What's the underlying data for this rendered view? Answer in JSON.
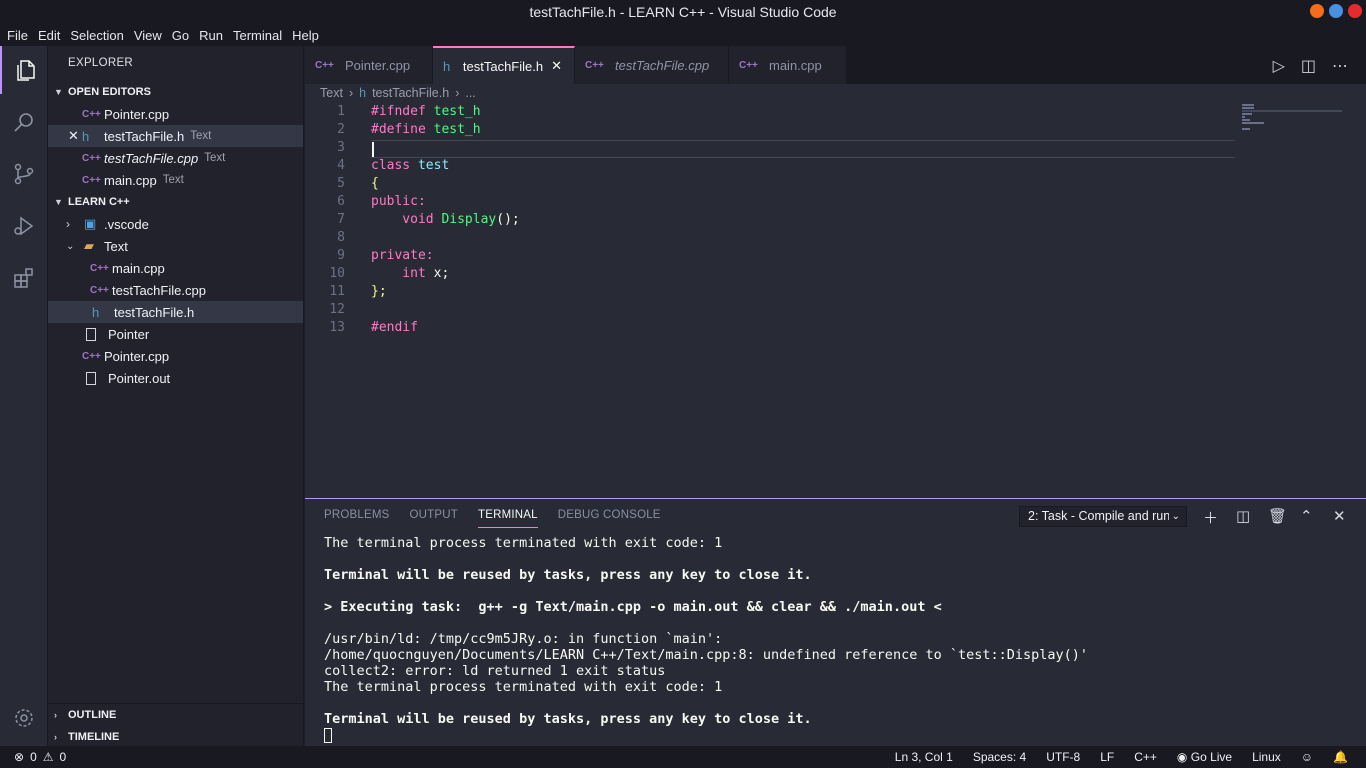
{
  "window": {
    "title": "testTachFile.h - LEARN C++ - Visual Studio Code",
    "buttons": {
      "minimize_color": "#f46d1b",
      "maximize_color": "#4a90e2",
      "close_color": "#e52b2b"
    }
  },
  "menu": [
    "File",
    "Edit",
    "Selection",
    "View",
    "Go",
    "Run",
    "Terminal",
    "Help"
  ],
  "activity": [
    "files-icon",
    "search-icon",
    "source-control-icon",
    "run-debug-icon",
    "extensions-icon",
    "settings-gear-icon"
  ],
  "sidebar": {
    "title": "EXPLORER",
    "open_editors": {
      "header": "OPEN EDITORS",
      "items": [
        {
          "name": "Pointer.cpp",
          "desc": "",
          "icon": "cpp"
        },
        {
          "name": "testTachFile.h",
          "desc": "Text",
          "icon": "h"
        },
        {
          "name": "testTachFile.cpp",
          "desc": "Text",
          "icon": "cpp"
        },
        {
          "name": "main.cpp",
          "desc": "Text",
          "icon": "cpp"
        }
      ]
    },
    "workspace": {
      "header": "LEARN C++",
      "items": [
        {
          "name": ".vscode",
          "type": "folder-collapsed"
        },
        {
          "name": "Text",
          "type": "folder-open"
        },
        {
          "name": "main.cpp",
          "type": "cpp"
        },
        {
          "name": "testTachFile.cpp",
          "type": "cpp"
        },
        {
          "name": "testTachFile.h",
          "type": "h"
        },
        {
          "name": "Pointer",
          "type": "file"
        },
        {
          "name": "Pointer.cpp",
          "type": "cpp"
        },
        {
          "name": "Pointer.out",
          "type": "file"
        }
      ]
    },
    "outline": "OUTLINE",
    "timeline": "TIMELINE"
  },
  "tabs": [
    {
      "label": "Pointer.cpp",
      "icon": "C++"
    },
    {
      "label": "testTachFile.h",
      "icon": "h"
    },
    {
      "label": "testTachFile.cpp",
      "icon": "C++"
    },
    {
      "label": "main.cpp",
      "icon": "C++"
    }
  ],
  "breadcrumb": {
    "folder": "Text",
    "file": "testTachFile.h",
    "more": "..."
  },
  "editor": {
    "lines": [
      [
        {
          "t": "#ifndef ",
          "c": "kw"
        },
        {
          "t": "test_h",
          "c": "fn"
        }
      ],
      [
        {
          "t": "#define ",
          "c": "kw"
        },
        {
          "t": "test_h",
          "c": "fn"
        }
      ],
      [],
      [
        {
          "t": "class ",
          "c": "kw"
        },
        {
          "t": "test",
          "c": "cls"
        }
      ],
      [
        {
          "t": "{",
          "c": "br"
        }
      ],
      [
        {
          "t": "public:",
          "c": "kw"
        }
      ],
      [
        {
          "t": "    void ",
          "c": "kw"
        },
        {
          "t": "Display",
          "c": "fn"
        },
        {
          "t": "();",
          "c": "pl"
        }
      ],
      [],
      [
        {
          "t": "private:",
          "c": "kw"
        }
      ],
      [
        {
          "t": "    int ",
          "c": "kw"
        },
        {
          "t": "x;",
          "c": "pl"
        }
      ],
      [
        {
          "t": "};",
          "c": "br"
        }
      ],
      [],
      [
        {
          "t": "#endif",
          "c": "kw"
        }
      ]
    ]
  },
  "panel": {
    "tabs": [
      "PROBLEMS",
      "OUTPUT",
      "TERMINAL",
      "DEBUG CONSOLE"
    ],
    "select": "2: Task - Compile and run",
    "terminal": [
      {
        "t": "The terminal process terminated with exit code: 1",
        "b": false
      },
      {
        "t": "",
        "b": false
      },
      {
        "t": "Terminal will be reused by tasks, press any key to close it.",
        "b": true
      },
      {
        "t": "",
        "b": false
      },
      {
        "t": "> Executing task:  g++ -g Text/main.cpp -o main.out && clear && ./main.out <",
        "b": true
      },
      {
        "t": "",
        "b": false
      },
      {
        "t": "/usr/bin/ld: /tmp/cc9m5JRy.o: in function `main':",
        "b": false
      },
      {
        "t": "/home/quocnguyen/Documents/LEARN C++/Text/main.cpp:8: undefined reference to `test::Display()'",
        "b": false
      },
      {
        "t": "collect2: error: ld returned 1 exit status",
        "b": false
      },
      {
        "t": "The terminal process terminated with exit code: 1",
        "b": false
      },
      {
        "t": "",
        "b": false
      },
      {
        "t": "Terminal will be reused by tasks, press any key to close it.",
        "b": true
      }
    ]
  },
  "status": {
    "errors": "0",
    "warnings": "0",
    "position": "Ln 3, Col 1",
    "spaces": "Spaces: 4",
    "encoding": "UTF-8",
    "eol": "LF",
    "language": "C++",
    "golive": "Go Live",
    "os": "Linux"
  }
}
